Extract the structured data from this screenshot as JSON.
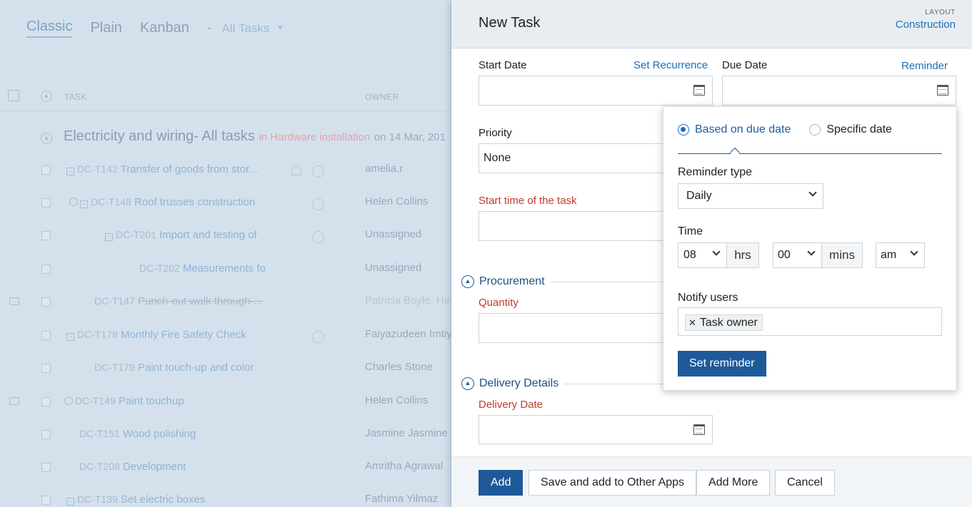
{
  "view_tabs": {
    "classic": "Classic",
    "plain": "Plain",
    "kanban": "Kanban",
    "separator": "-",
    "filter": "All Tasks"
  },
  "list_header": {
    "task": "TASK",
    "owner": "OWNER"
  },
  "group": {
    "title": "Electricity and wiring- All tasks",
    "in_text": "in Hardware installation",
    "on_text": "on 14 Mar, 201"
  },
  "tasks": [
    {
      "code": "DC-T142",
      "name": "Transfer of goods from stor...",
      "owner": "amelia.r"
    },
    {
      "code": "DC-T148",
      "name": "Roof trusses construction",
      "owner": "Helen Collins"
    },
    {
      "code": "DC-T201",
      "name": "Import and testing of",
      "owner": "Unassigned"
    },
    {
      "code": "DC-T202",
      "name": "Measurements fo",
      "owner": "Unassigned"
    },
    {
      "code": "DC-T147",
      "name": "Punch-out walk through-...",
      "owner": "Patricia Boyle, He"
    },
    {
      "code": "DC-T178",
      "name": "Monthly Fire Safety Check",
      "owner": "Faiyazudeen Imtiy"
    },
    {
      "code": "DC-T179",
      "name": "Paint touch-up and color",
      "owner": "Charles Stone"
    },
    {
      "code": "DC-T149",
      "name": "Paint touchup",
      "owner": "Helen Collins"
    },
    {
      "code": "DC-T151",
      "name": "Wood polishing",
      "owner": "Jasmine Jasmine P"
    },
    {
      "code": "DC-T208",
      "name": "Development",
      "owner": "Amritha Agrawal"
    },
    {
      "code": "DC-T139",
      "name": "Set electric boxes",
      "owner": "Fathima Yilmaz"
    }
  ],
  "panel": {
    "title": "New Task",
    "layout_label": "LAYOUT",
    "layout_value": "Construction",
    "start_date_label": "Start Date",
    "set_recurrence": "Set Recurrence",
    "due_date_label": "Due Date",
    "reminder_link": "Reminder",
    "priority_label": "Priority",
    "priority_value": "None",
    "start_time_label": "Start time of the task",
    "procurement_title": "Procurement",
    "quantity_label": "Quantity",
    "delivery_title": "Delivery Details",
    "delivery_date_label": "Delivery Date"
  },
  "footer": {
    "add": "Add",
    "save_other": "Save and add to Other Apps",
    "add_more": "Add More",
    "cancel": "Cancel"
  },
  "reminder": {
    "option_due": "Based on due date",
    "option_specific": "Specific date",
    "type_label": "Reminder type",
    "type_value": "Daily",
    "time_label": "Time",
    "hours": "08",
    "hrs_unit": "hrs",
    "minutes": "00",
    "mins_unit": "mins",
    "ampm": "am",
    "notify_label": "Notify users",
    "chip": "Task owner",
    "set_button": "Set reminder"
  }
}
